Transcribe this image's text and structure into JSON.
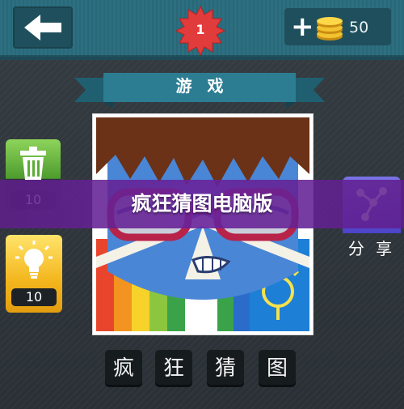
{
  "header": {
    "level": "1",
    "coin_count": "50",
    "add_symbol": "+"
  },
  "ribbon": {
    "title": "游 戏"
  },
  "tools": {
    "remove_cost": "10",
    "hint_cost": "10",
    "share_label": "分 享"
  },
  "banner": {
    "title": "疯狂猜图电脑版"
  },
  "answer": {
    "tiles": [
      "疯",
      "狂",
      "猜",
      "图"
    ]
  },
  "colors": {
    "topbar": "#2c6f80",
    "level_badge": "#e23b3b",
    "trash_green": "#5cae36",
    "hint_yellow": "#f3b51c",
    "share_purple": "#5b52d6",
    "banner_purple": "#6a239b"
  },
  "icons": [
    "back-arrow-icon",
    "level-star-badge",
    "coin-stack-icon",
    "trash-icon",
    "bulb-icon",
    "share-icon"
  ]
}
